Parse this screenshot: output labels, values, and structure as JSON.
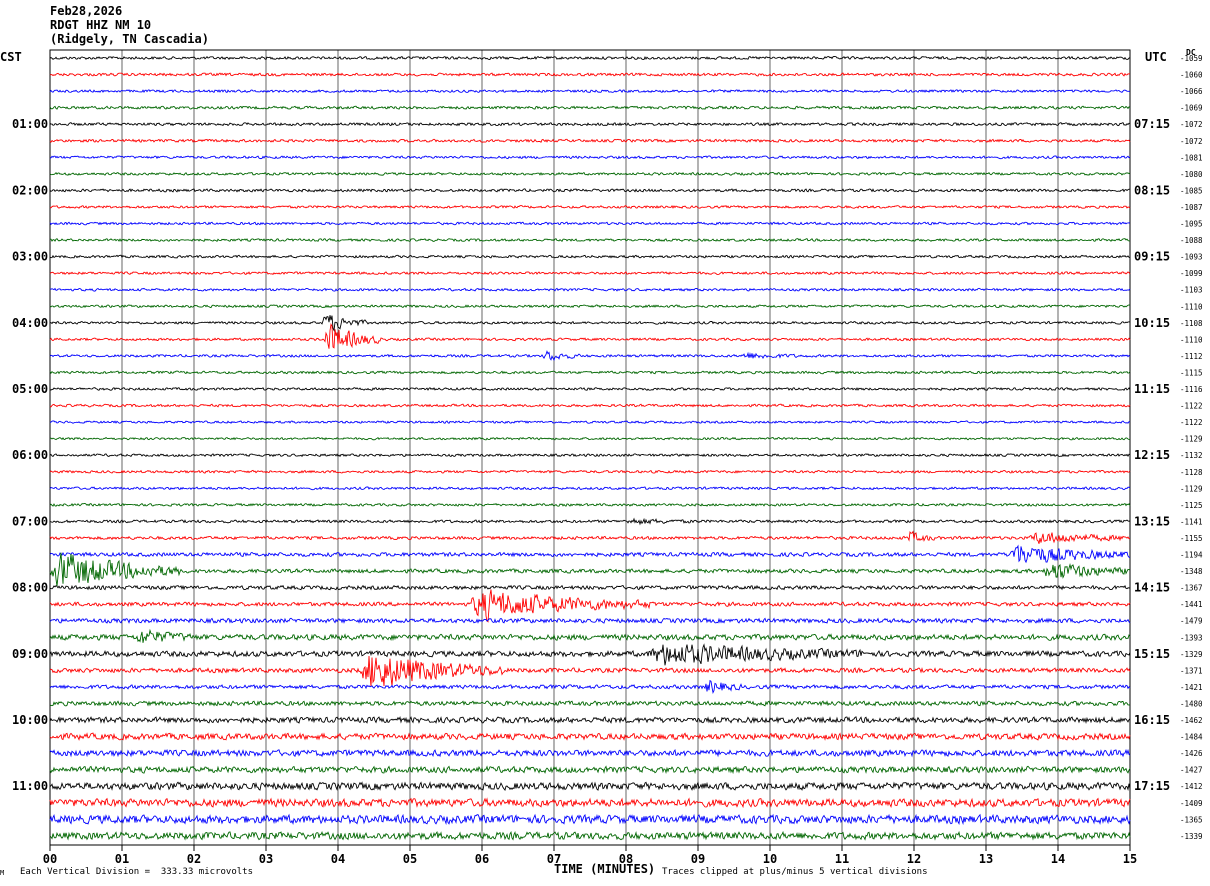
{
  "header": {
    "date": "Feb28,2026",
    "station": "RDGT HHZ NM 10",
    "location": "(Ridgely, TN Cascadia)"
  },
  "left_label": "CST",
  "right_label": "UTC",
  "corner_label": "DC",
  "footer": {
    "scale_note": "Each Vertical Division =  333.33 microvolts",
    "clip_note": "Traces clipped at plus/minus 5 vertical divisions",
    "corner_mark": "M"
  },
  "chart_data": {
    "type": "line",
    "title": "",
    "xlabel": "TIME (MINUTES)",
    "ylabel": "",
    "xlim": [
      0,
      15
    ],
    "x_tick_labels": [
      "00",
      "01",
      "02",
      "03",
      "04",
      "05",
      "06",
      "07",
      "08",
      "09",
      "10",
      "11",
      "12",
      "13",
      "14",
      "15"
    ],
    "grid": "vertical lines each minute",
    "trace_colors": [
      "#000000",
      "#ff0000",
      "#0000ff",
      "#006600"
    ],
    "trace_count": 48,
    "left_time_labels": [
      {
        "row": 4,
        "text": "01:00"
      },
      {
        "row": 8,
        "text": "02:00"
      },
      {
        "row": 12,
        "text": "03:00"
      },
      {
        "row": 16,
        "text": "04:00"
      },
      {
        "row": 20,
        "text": "05:00"
      },
      {
        "row": 24,
        "text": "06:00"
      },
      {
        "row": 28,
        "text": "07:00"
      },
      {
        "row": 32,
        "text": "08:00"
      },
      {
        "row": 36,
        "text": "09:00"
      },
      {
        "row": 40,
        "text": "10:00"
      },
      {
        "row": 44,
        "text": "11:00"
      }
    ],
    "right_time_labels": [
      {
        "row": 4,
        "text": "07:15"
      },
      {
        "row": 8,
        "text": "08:15"
      },
      {
        "row": 12,
        "text": "09:15"
      },
      {
        "row": 16,
        "text": "10:15"
      },
      {
        "row": 20,
        "text": "11:15"
      },
      {
        "row": 24,
        "text": "12:15"
      },
      {
        "row": 28,
        "text": "13:15"
      },
      {
        "row": 32,
        "text": "14:15"
      },
      {
        "row": 36,
        "text": "15:15"
      },
      {
        "row": 40,
        "text": "16:15"
      },
      {
        "row": 44,
        "text": "17:15"
      }
    ],
    "dc_offsets": [
      "-1059",
      "-1060",
      "-1066",
      "-1069",
      "-1072",
      "-1072",
      "-1081",
      "-1080",
      "-1085",
      "-1087",
      "-1095",
      "-1088",
      "-1093",
      "-1099",
      "-1103",
      "-1110",
      "-1108",
      "-1110",
      "-1112",
      "-1115",
      "-1116",
      "-1122",
      "-1122",
      "-1129",
      "-1132",
      "-1128",
      "-1129",
      "-1125",
      "-1141",
      "-1155",
      "-1194",
      "-1348",
      "-1367",
      "-1441",
      "-1479",
      "-1393",
      "-1329",
      "-1371",
      "-1421",
      "-1480",
      "-1462",
      "-1484",
      "-1426",
      "-1427",
      "-1412",
      "-1409",
      "-1365",
      "-1339"
    ],
    "noise_level": [
      1.0,
      1.0,
      0.9,
      1.0,
      1.0,
      1.0,
      0.9,
      0.9,
      1.0,
      0.9,
      0.9,
      0.9,
      0.9,
      0.9,
      0.9,
      0.9,
      0.9,
      0.9,
      0.9,
      0.9,
      0.9,
      0.9,
      0.8,
      0.8,
      0.9,
      0.9,
      0.9,
      0.9,
      1.0,
      1.1,
      1.4,
      1.4,
      1.4,
      1.4,
      1.6,
      2.0,
      2.0,
      1.6,
      1.4,
      1.6,
      2.0,
      2.2,
      2.2,
      2.2,
      2.6,
      2.8,
      3.0,
      2.6
    ],
    "events": [
      {
        "row": 16,
        "minute": 3.78,
        "duration_min": 0.6,
        "amplitude": 14
      },
      {
        "row": 17,
        "minute": 3.8,
        "duration_min": 0.8,
        "amplitude": 22
      },
      {
        "row": 18,
        "minute": 6.85,
        "duration_min": 0.5,
        "amplitude": 7
      },
      {
        "row": 18,
        "minute": 9.6,
        "duration_min": 0.8,
        "amplitude": 4
      },
      {
        "row": 28,
        "minute": 8.0,
        "duration_min": 1.0,
        "amplitude": 3
      },
      {
        "row": 29,
        "minute": 11.9,
        "duration_min": 0.4,
        "amplitude": 8
      },
      {
        "row": 29,
        "minute": 13.6,
        "duration_min": 1.4,
        "amplitude": 8
      },
      {
        "row": 30,
        "minute": 13.3,
        "duration_min": 1.7,
        "amplitude": 14
      },
      {
        "row": 31,
        "minute": 0.0,
        "duration_min": 1.8,
        "amplitude": 26
      },
      {
        "row": 31,
        "minute": 13.8,
        "duration_min": 1.2,
        "amplitude": 12
      },
      {
        "row": 33,
        "minute": 5.8,
        "duration_min": 2.6,
        "amplitude": 20
      },
      {
        "row": 35,
        "minute": 1.2,
        "duration_min": 0.8,
        "amplitude": 9
      },
      {
        "row": 36,
        "minute": 8.3,
        "duration_min": 3.0,
        "amplitude": 14
      },
      {
        "row": 37,
        "minute": 4.3,
        "duration_min": 2.0,
        "amplitude": 26
      },
      {
        "row": 38,
        "minute": 9.1,
        "duration_min": 0.5,
        "amplitude": 9
      }
    ]
  }
}
